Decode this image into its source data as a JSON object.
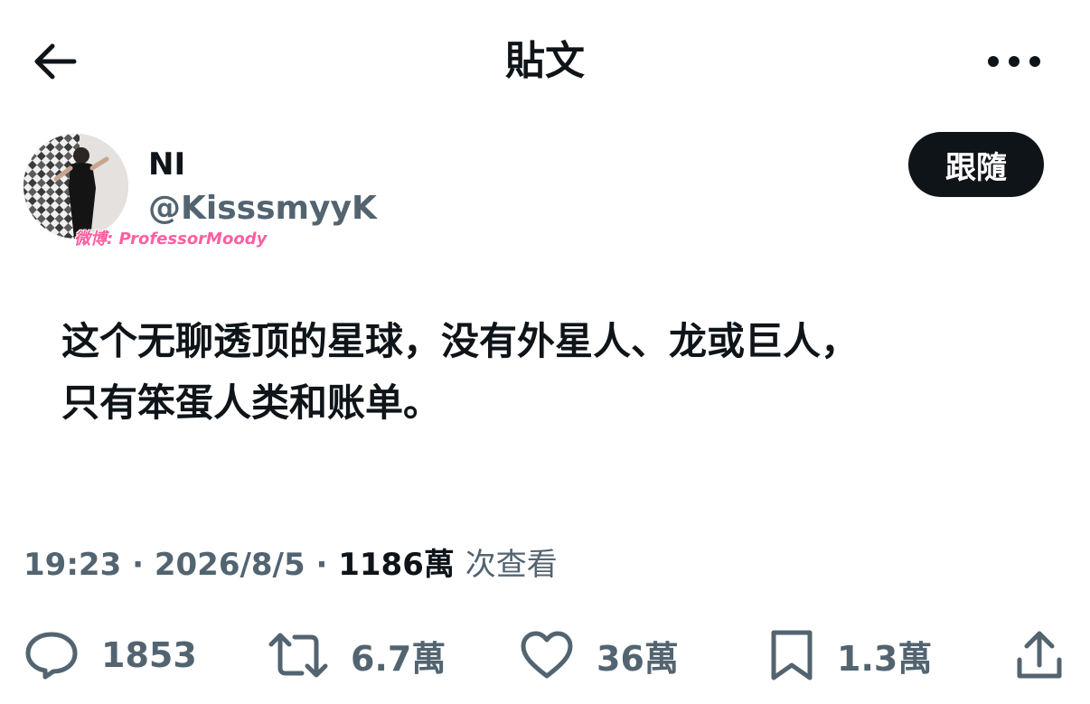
{
  "header": {
    "title": "貼文",
    "back_icon": "arrow-left-icon",
    "more_icon": "more-horizontal-icon"
  },
  "author": {
    "name": "NI",
    "handle": "@KisssmyyK",
    "follow_label": "跟隨"
  },
  "watermark": "微博: ProfessorMoody",
  "post": {
    "text_line1": "这个无聊透顶的星球，没有外星人、龙或巨人，",
    "text_line2": "只有笨蛋人类和账单。",
    "time": "19:23",
    "date": "2026/8/5",
    "views": "1186萬",
    "views_label": "次查看"
  },
  "actions": {
    "replies": "1853",
    "reposts": "6.7萬",
    "likes": "36萬",
    "bookmarks": "1.3萬"
  },
  "colors": {
    "text": "#0f1419",
    "secondary": "#536471",
    "button_bg": "#0f1419"
  }
}
